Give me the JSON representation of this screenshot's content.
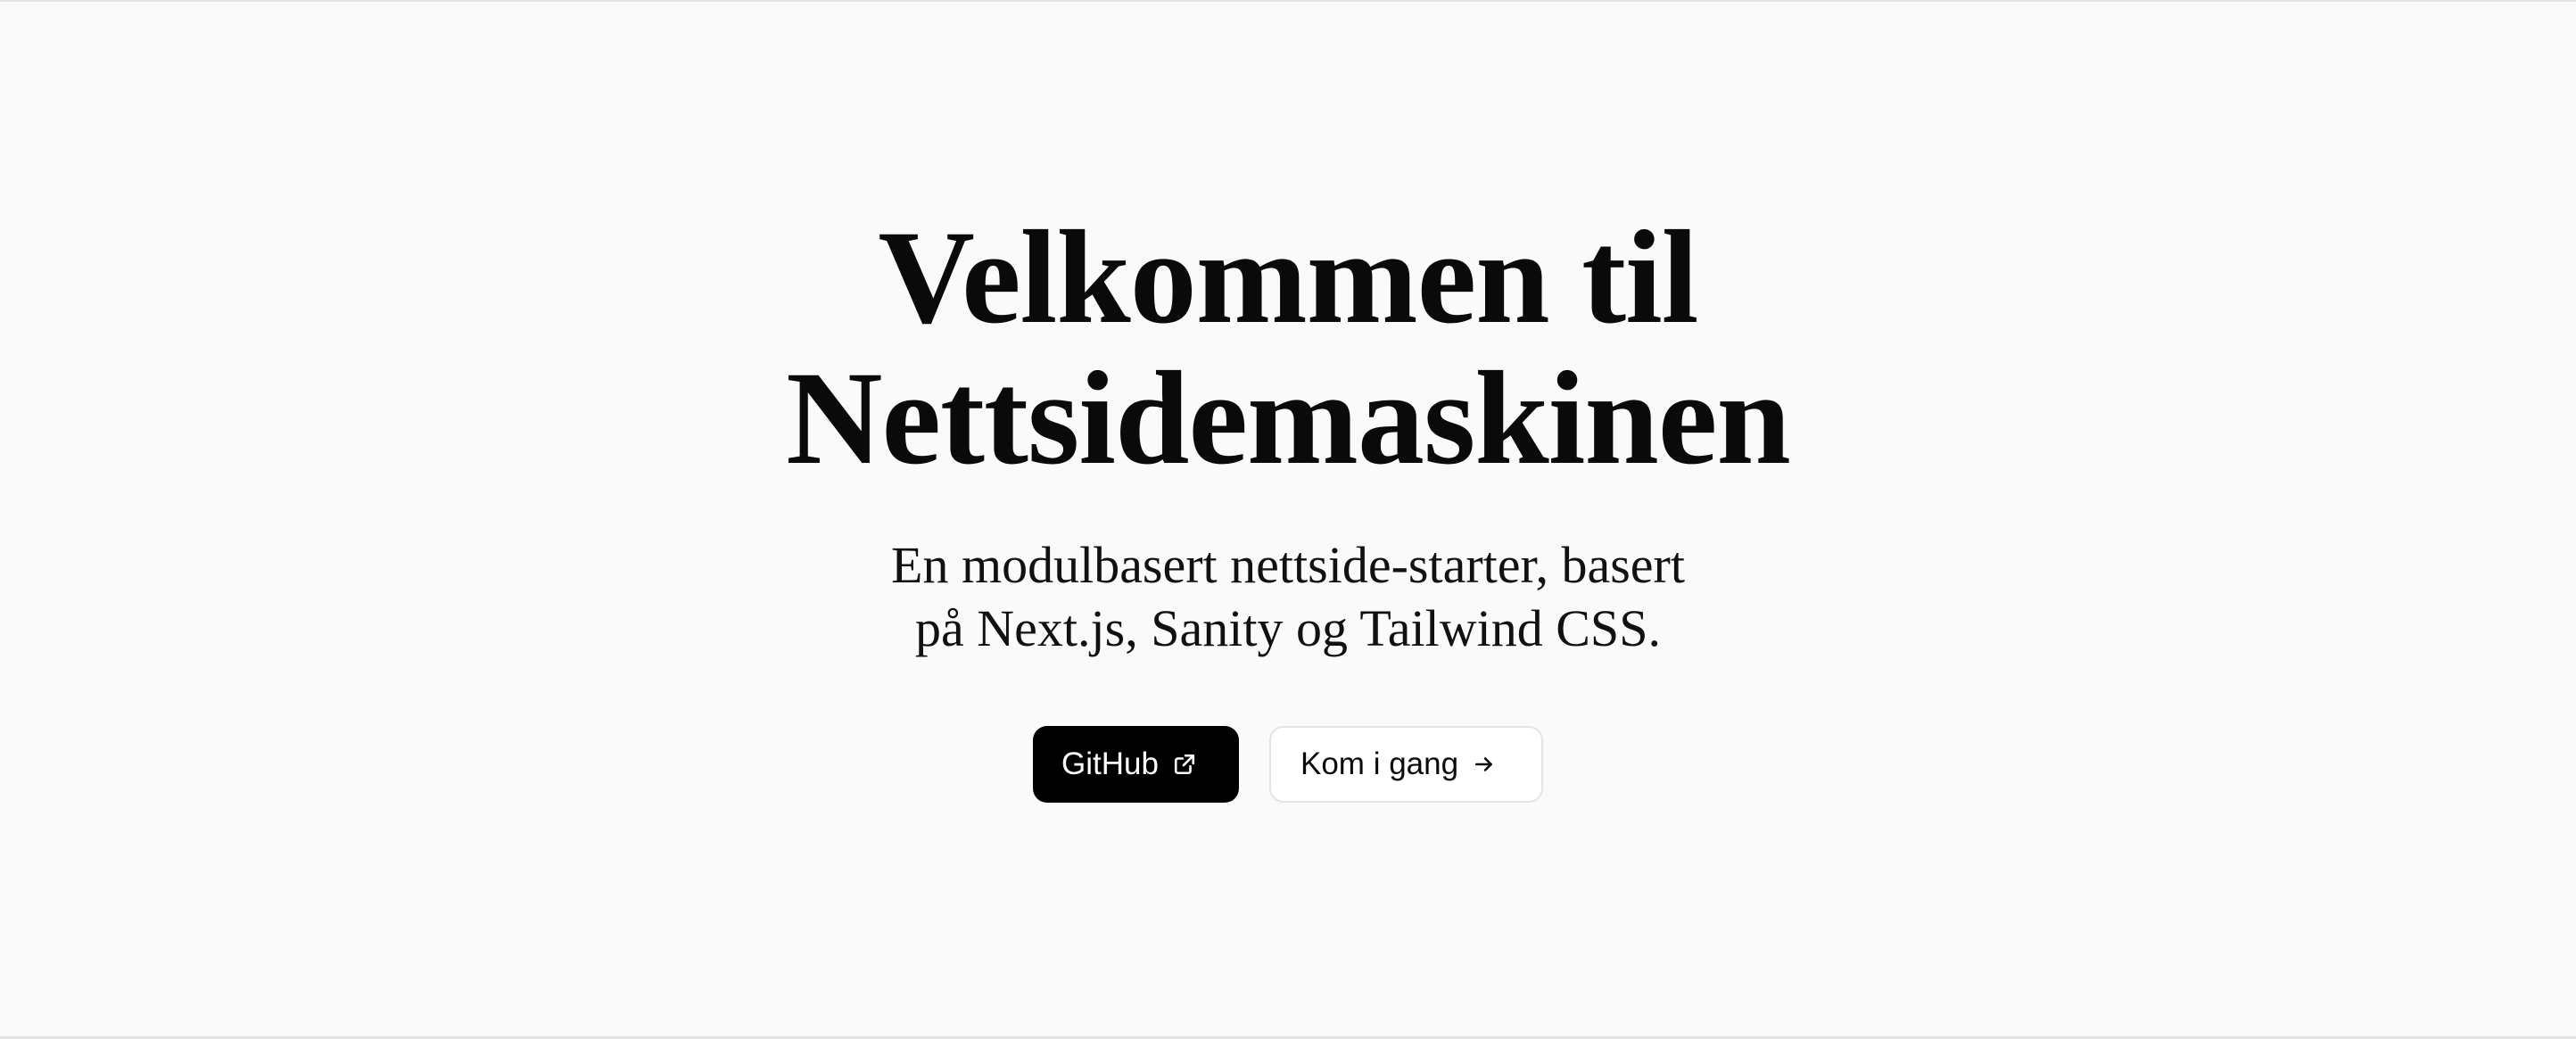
{
  "hero": {
    "title_line1": "Velkommen til",
    "title_line2": "Nettsidemaskinen",
    "subtitle_line1": "En modulbasert nettside-starter, basert",
    "subtitle_line2": "på Next.js, Sanity og Tailwind CSS."
  },
  "actions": {
    "github": {
      "label": "GitHub",
      "icon": "external-link-icon"
    },
    "get_started": {
      "label": "Kom i gang",
      "icon": "arrow-right-icon"
    }
  },
  "colors": {
    "background": "#fafafa",
    "primary_button": "#000000",
    "secondary_button": "#ffffff",
    "text": "#0a0a0a",
    "border": "#e4e4e7"
  }
}
